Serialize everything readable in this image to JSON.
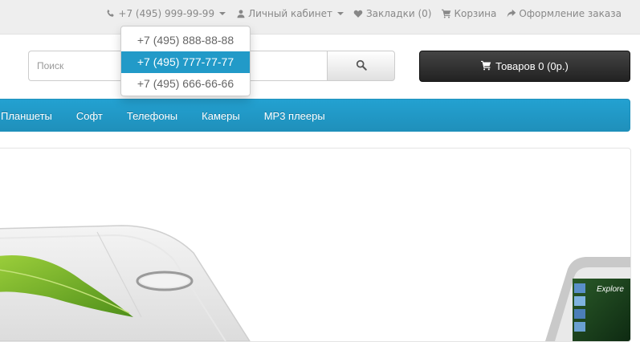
{
  "topbar": {
    "phone": "+7 (495) 999-99-99",
    "account": "Личный кабинет",
    "wishlist": "Закладки (0)",
    "cart": "Корзина",
    "checkout": "Оформление заказа"
  },
  "phone_dropdown": {
    "items": [
      "+7 (495) 888-88-88",
      "+7 (495) 777-77-77",
      "+7 (495) 666-66-66"
    ],
    "highlighted_index": 1
  },
  "search": {
    "placeholder": "Поиск"
  },
  "cart_button": {
    "label": "Товаров 0 (0р.)"
  },
  "menu": {
    "items": [
      "Планшеты",
      "Софт",
      "Телефоны",
      "Камеры",
      "MP3 плееры"
    ]
  },
  "colors": {
    "accent": "#229ac8",
    "cart_button_bg": "#333333",
    "topbar_bg": "#eeeeee"
  },
  "banner": {
    "screen_text": "Explore"
  }
}
